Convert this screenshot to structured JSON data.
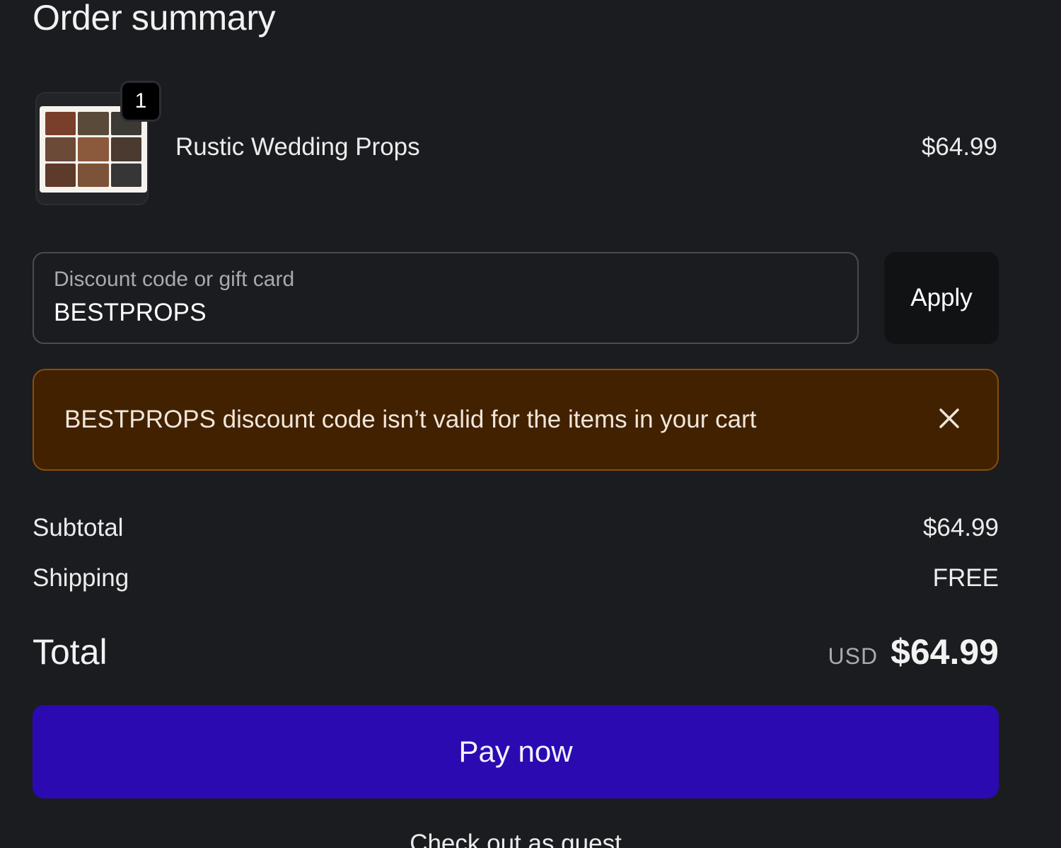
{
  "summary": {
    "title": "Order summary"
  },
  "product": {
    "quantity": "1",
    "name": "Rustic Wedding Props",
    "price": "$64.99"
  },
  "discount": {
    "label": "Discount code or gift card",
    "value": "BESTPROPS",
    "apply_label": "Apply"
  },
  "alert": {
    "message": "BESTPROPS discount code isn’t valid for the items in your cart"
  },
  "totals": {
    "subtotal_label": "Subtotal",
    "subtotal_value": "$64.99",
    "shipping_label": "Shipping",
    "shipping_value": "FREE",
    "total_label": "Total",
    "currency": "USD",
    "total_value": "$64.99"
  },
  "actions": {
    "pay_label": "Pay now",
    "guest_label": "Check out as guest"
  },
  "colors": {
    "background": "#1b1c1f",
    "accent": "#2b0ab2",
    "alert_bg": "#412100",
    "alert_border": "#8a4d0c"
  }
}
